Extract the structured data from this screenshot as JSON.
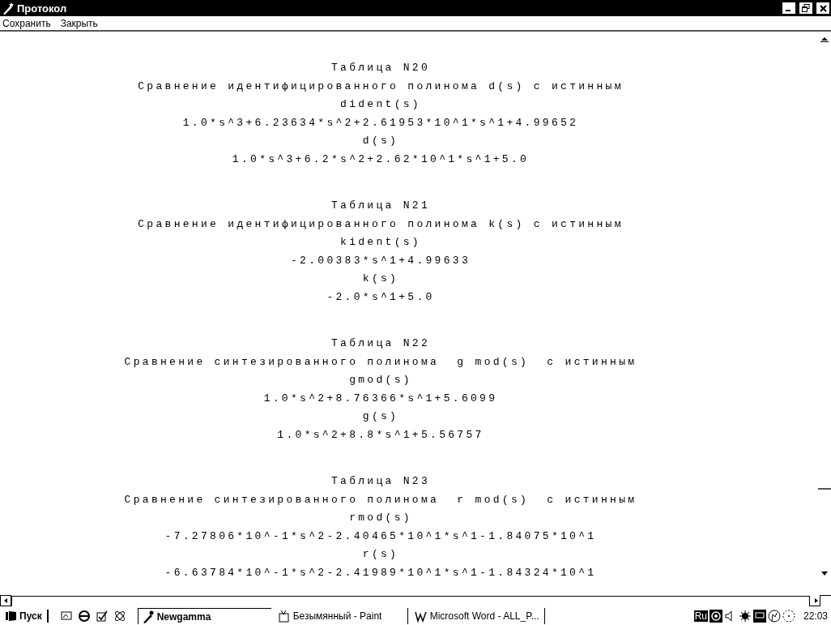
{
  "window": {
    "title": "Протокол"
  },
  "menu": [
    "Сохранить",
    "Закрыть"
  ],
  "tables": [
    {
      "title": "Таблица N20",
      "caption": "Сравнение идентифицированного полинома d(s) с истинным",
      "lines": [
        "dident(s)",
        "1.0*s^3+6.23634*s^2+2.61953*10^1*s^1+4.99652",
        "d(s)",
        "1.0*s^3+6.2*s^2+2.62*10^1*s^1+5.0"
      ]
    },
    {
      "title": "Таблица N21",
      "caption": "Сравнение идентифицированного полинома k(s) с истинным",
      "lines": [
        "kident(s)",
        "-2.00383*s^1+4.99633",
        "k(s)",
        "-2.0*s^1+5.0"
      ]
    },
    {
      "title": "Таблица N22",
      "caption": "Сравнение синтезированного полинома  g mod(s)  с истинным",
      "lines": [
        "gmod(s)",
        "1.0*s^2+8.76366*s^1+5.6099",
        "g(s)",
        "1.0*s^2+8.8*s^1+5.56757"
      ]
    },
    {
      "title": "Таблица N23",
      "caption": "Сравнение синтезированного полинома  r mod(s)  с истинным",
      "lines": [
        "rmod(s)",
        "-7.27806*10^-1*s^2-2.40465*10^1*s^1-1.84075*10^1",
        "r(s)",
        "-6.63784*10^-1*s^2-2.41989*10^1*s^1-1.84324*10^1"
      ]
    }
  ],
  "taskbar": {
    "start": "Пуск",
    "tasks": [
      {
        "label": "Newgamma",
        "selected": true
      },
      {
        "label": "Безымянный - Paint",
        "selected": false
      },
      {
        "label": "Microsoft Word - ALL_P...",
        "selected": false
      }
    ],
    "language": "Ru",
    "clock": "22:03"
  }
}
